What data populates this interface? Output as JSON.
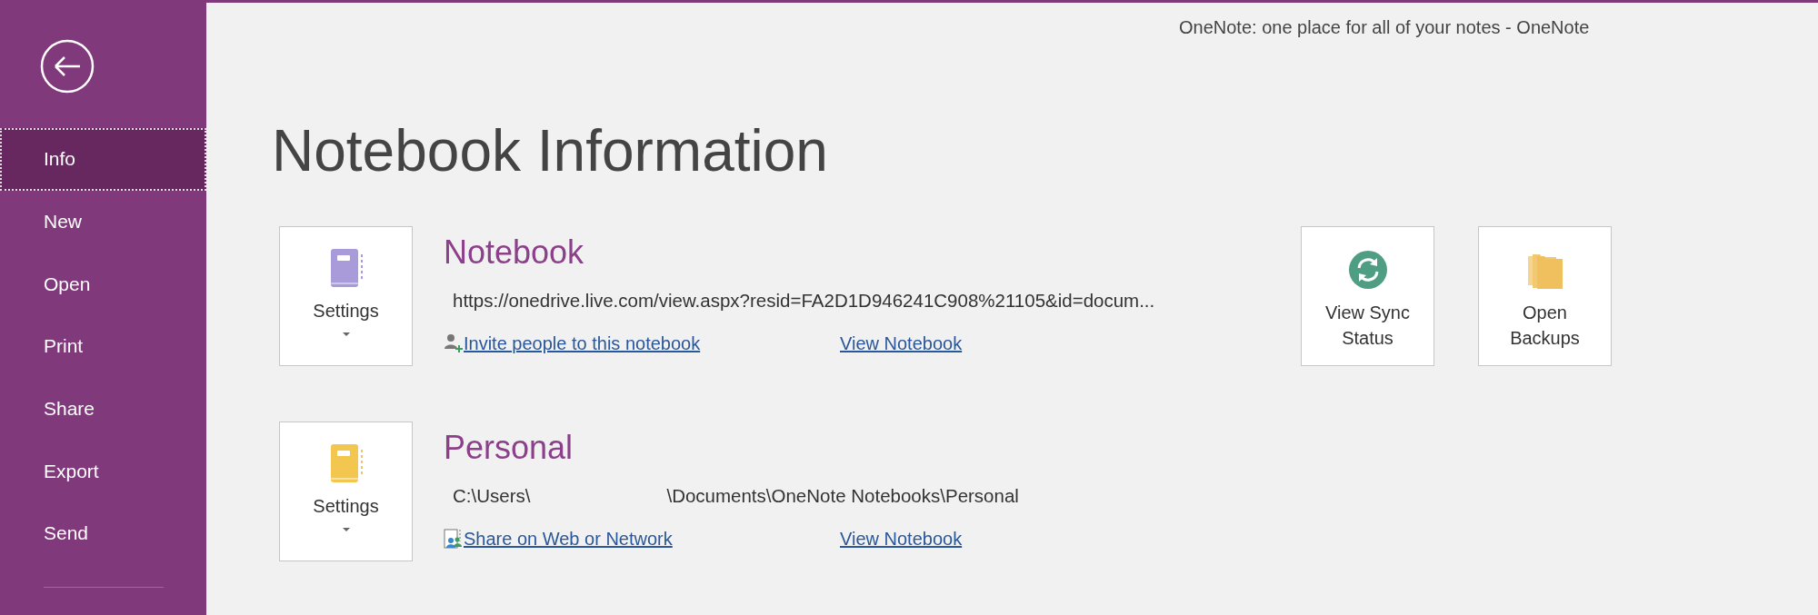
{
  "window": {
    "title": "OneNote: one place for all of your notes  -  OneNote"
  },
  "sidebar": {
    "items": [
      {
        "label": "Info",
        "selected": true
      },
      {
        "label": "New",
        "selected": false
      },
      {
        "label": "Open",
        "selected": false
      },
      {
        "label": "Print",
        "selected": false
      },
      {
        "label": "Share",
        "selected": false
      },
      {
        "label": "Export",
        "selected": false
      },
      {
        "label": "Send",
        "selected": false
      }
    ]
  },
  "heading": "Notebook Information",
  "notebooks": [
    {
      "name": "Notebook",
      "color": "#a99ad9",
      "settings_label": "Settings",
      "location": [
        "https://onedrive.live.com/view.aspx?resid=FA2D1D946241C908%21105&id=docum..."
      ],
      "share_link": {
        "kind": "invite",
        "label": "Invite people to this notebook"
      },
      "view_link": "View Notebook"
    },
    {
      "name": "Personal",
      "color": "#f3c74f",
      "settings_label": "Settings",
      "location": [
        "C:\\Users\\",
        "\\Documents\\OneNote Notebooks\\Personal"
      ],
      "share_link": {
        "kind": "web",
        "label": "Share on Web or Network"
      },
      "view_link": "View Notebook"
    }
  ],
  "actions": [
    {
      "kind": "sync",
      "label": "View Sync Status"
    },
    {
      "kind": "backups",
      "label": "Open Backups"
    }
  ]
}
